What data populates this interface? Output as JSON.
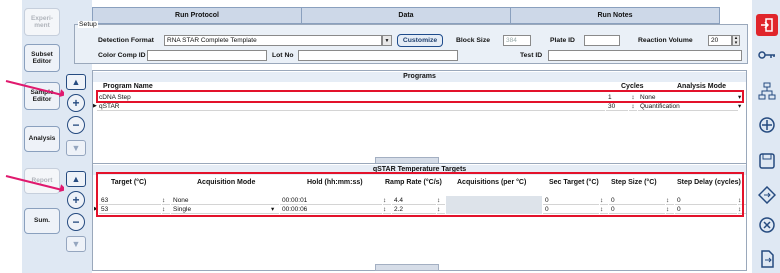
{
  "sidebar": {
    "items": [
      {
        "label": "Experi-\nment",
        "enabled": false
      },
      {
        "label": "Subset\nEditor",
        "enabled": true
      },
      {
        "label": "Sample\nEditor",
        "enabled": true
      },
      {
        "label": "Analysis",
        "enabled": true
      },
      {
        "label": "Report",
        "enabled": false
      },
      {
        "label": "Sum.",
        "enabled": true
      }
    ]
  },
  "tabs": [
    {
      "label": "Run Protocol",
      "active": true
    },
    {
      "label": "Data",
      "active": false
    },
    {
      "label": "Run Notes",
      "active": false
    }
  ],
  "setup": {
    "legend": "Setup",
    "detection_format_label": "Detection Format",
    "detection_format_value": "RNA STAR Complete Template",
    "customize_label": "Customize",
    "block_size_label": "Block Size",
    "block_size_value": "384",
    "plate_id_label": "Plate ID",
    "plate_id_value": "",
    "reaction_volume_label": "Reaction Volume",
    "reaction_volume_value": "20",
    "color_comp_label": "Color Comp ID",
    "color_comp_value": "",
    "lot_no_label": "Lot No",
    "lot_no_value": "",
    "test_id_label": "Test ID",
    "test_id_value": ""
  },
  "programs": {
    "title": "Programs",
    "columns": [
      "Program Name",
      "Cycles",
      "Analysis Mode"
    ],
    "rows": [
      {
        "name": "cDNA Step",
        "cycles": "1",
        "mode": "None"
      },
      {
        "name": "qSTAR",
        "cycles": "30",
        "mode": "Quantification"
      }
    ]
  },
  "targets": {
    "title": "qSTAR Temperature Targets",
    "columns": [
      "Target (°C)",
      "Acquisition Mode",
      "Hold (hh:mm:ss)",
      "Ramp Rate (°C/s)",
      "Acquisitions (per °C)",
      "Sec Target (°C)",
      "Step Size (°C)",
      "Step Delay (cycles)"
    ],
    "rows": [
      {
        "target": "63",
        "mode": "None",
        "hold": "00:00:01",
        "ramp": "4.4",
        "acq": "",
        "sec": "0",
        "step": "0",
        "delay": "0"
      },
      {
        "target": "53",
        "mode": "Single",
        "hold": "00:00:06",
        "ramp": "2.2",
        "acq": "",
        "sec": "0",
        "step": "0",
        "delay": "0"
      }
    ]
  },
  "colors": {
    "highlight": "#e3122b",
    "arrow": "#e0196e",
    "accent": "#1f4c8c",
    "tool_red": "#e0252b"
  },
  "right_toolbar": [
    "exit-icon",
    "key-icon",
    "network-icon",
    "settings-dial-icon",
    "save-icon",
    "navigate-icon",
    "close-icon",
    "export-icon"
  ]
}
